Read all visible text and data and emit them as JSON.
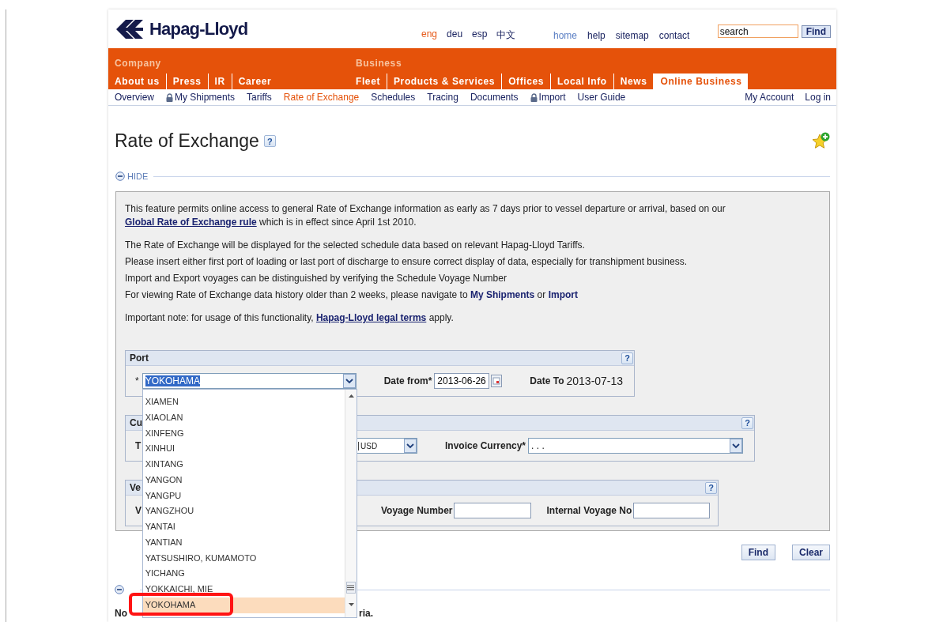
{
  "header": {
    "logo": "Hapag-Lloyd",
    "languages": [
      {
        "label": "eng",
        "selected": true
      },
      {
        "label": "deu",
        "selected": false
      },
      {
        "label": "esp",
        "selected": false
      },
      {
        "label": "中文",
        "selected": false
      }
    ],
    "links": [
      {
        "label": "home",
        "selected": true
      },
      {
        "label": "help",
        "selected": false
      },
      {
        "label": "sitemap",
        "selected": false
      },
      {
        "label": "contact",
        "selected": false
      }
    ],
    "search": {
      "value": "search"
    },
    "search_button": "Find"
  },
  "navbar": {
    "groups": [
      {
        "title": "Company",
        "items": [
          {
            "label": "About us",
            "selected": false
          },
          {
            "label": "Press",
            "selected": false
          },
          {
            "label": "IR",
            "selected": false
          },
          {
            "label": "Career",
            "selected": false
          }
        ]
      },
      {
        "title": "Business",
        "items": [
          {
            "label": "Fleet",
            "selected": false
          },
          {
            "label": "Products & Services",
            "selected": false
          },
          {
            "label": "Offices",
            "selected": false
          },
          {
            "label": "Local Info",
            "selected": false
          },
          {
            "label": "News",
            "selected": false
          },
          {
            "label": "Online Business",
            "selected": true
          }
        ]
      }
    ]
  },
  "subnav": {
    "items": [
      {
        "label": "Overview",
        "locked": false,
        "selected": false
      },
      {
        "label": "My Shipments",
        "locked": true,
        "selected": false
      },
      {
        "label": "Tariffs",
        "locked": false,
        "selected": false
      },
      {
        "label": "Rate of Exchange",
        "locked": false,
        "selected": true
      },
      {
        "label": "Schedules",
        "locked": false,
        "selected": false
      },
      {
        "label": "Tracing",
        "locked": false,
        "selected": false
      },
      {
        "label": "Documents",
        "locked": false,
        "selected": false
      },
      {
        "label": "Import",
        "locked": true,
        "selected": false
      },
      {
        "label": "User Guide",
        "locked": false,
        "selected": false
      }
    ],
    "right": [
      "My Account",
      "Log in"
    ]
  },
  "page": {
    "title": "Rate of Exchange",
    "help": "?"
  },
  "toggle": {
    "label": "HIDE",
    "expanded": true
  },
  "intro": {
    "blocks": [
      {
        "lines": [
          [
            {
              "kind": "text",
              "text": "This feature permits online access to general Rate of Exchange information as early as 7 days prior to vessel departure or arrival, based on our "
            },
            {
              "kind": "link",
              "text": "Global Rate of Exchange rule"
            },
            {
              "kind": "text",
              "text": " which is in effect since April 1st 2010."
            }
          ]
        ]
      },
      {
        "lines": [
          [
            {
              "kind": "text",
              "text": "The Rate of Exchange will be displayed for the selected schedule data based on relevant Hapag-Lloyd Tariffs."
            }
          ],
          [
            {
              "kind": "text",
              "text": "Please insert either first port of loading or last port of discharge to ensure correct display of data, especially for transhipment business."
            }
          ],
          [
            {
              "kind": "text",
              "text": "Import and Export voyages can be distinguished by verifying the Schedule Voyage Number"
            }
          ],
          [
            {
              "kind": "text",
              "text": "For viewing Rate of Exchange data history older than 2 weeks, please navigate to "
            },
            {
              "kind": "bold_link",
              "text": "My Shipments"
            },
            {
              "kind": "text",
              "text": " or "
            },
            {
              "kind": "bold_link",
              "text": "Import"
            }
          ]
        ]
      },
      {
        "lines": [
          [
            {
              "kind": "text",
              "text": "Important note:  for usage of this functionality, "
            },
            {
              "kind": "link",
              "text": "Hapag-Lloyd legal terms"
            },
            {
              "kind": "text",
              "text": " apply."
            }
          ]
        ]
      }
    ]
  },
  "port": {
    "title": "Port",
    "help": "?",
    "required_mark": "*",
    "value": "YOKOHAMA",
    "value_highlighted": true,
    "date_from_label": "Date from*",
    "date_from": "2013-06-26",
    "date_to_label": "Date To",
    "date_to": "2013-07-13"
  },
  "port_dropdown": {
    "items": [
      {
        "label": "XIAMEN",
        "selected": false,
        "marked": false
      },
      {
        "label": "XIAOLAN",
        "selected": false,
        "marked": false
      },
      {
        "label": "XINFENG",
        "selected": false,
        "marked": false
      },
      {
        "label": "XINHUI",
        "selected": false,
        "marked": false
      },
      {
        "label": "XINTANG",
        "selected": false,
        "marked": false
      },
      {
        "label": "YANGON",
        "selected": false,
        "marked": false
      },
      {
        "label": "YANGPU",
        "selected": false,
        "marked": false
      },
      {
        "label": "YANGZHOU",
        "selected": false,
        "marked": false
      },
      {
        "label": "YANTAI",
        "selected": false,
        "marked": false
      },
      {
        "label": "YANTIAN",
        "selected": false,
        "marked": false
      },
      {
        "label": "YATSUSHIRO, KUMAMOTO",
        "selected": false,
        "marked": false
      },
      {
        "label": "YICHANG",
        "selected": false,
        "marked": false
      },
      {
        "label": "YOKKAICHI, MIE",
        "selected": false,
        "marked": false
      },
      {
        "label": "YOKOHAMA",
        "selected": true,
        "marked": true
      }
    ]
  },
  "currency": {
    "title": "Cu",
    "help": "?",
    "label": "T",
    "value": "USD",
    "invoice_label": "Invoice Currency*",
    "invoice_value": ". . ."
  },
  "vessel": {
    "title": "Ve",
    "help": "?",
    "label": "V",
    "voyage_label": "Voyage Number",
    "internal_label": "Internal Voyage No"
  },
  "buttons": [
    "Find",
    "Clear"
  ],
  "results": {
    "expanded": true,
    "text_start": "No",
    "text_end": "ria."
  }
}
